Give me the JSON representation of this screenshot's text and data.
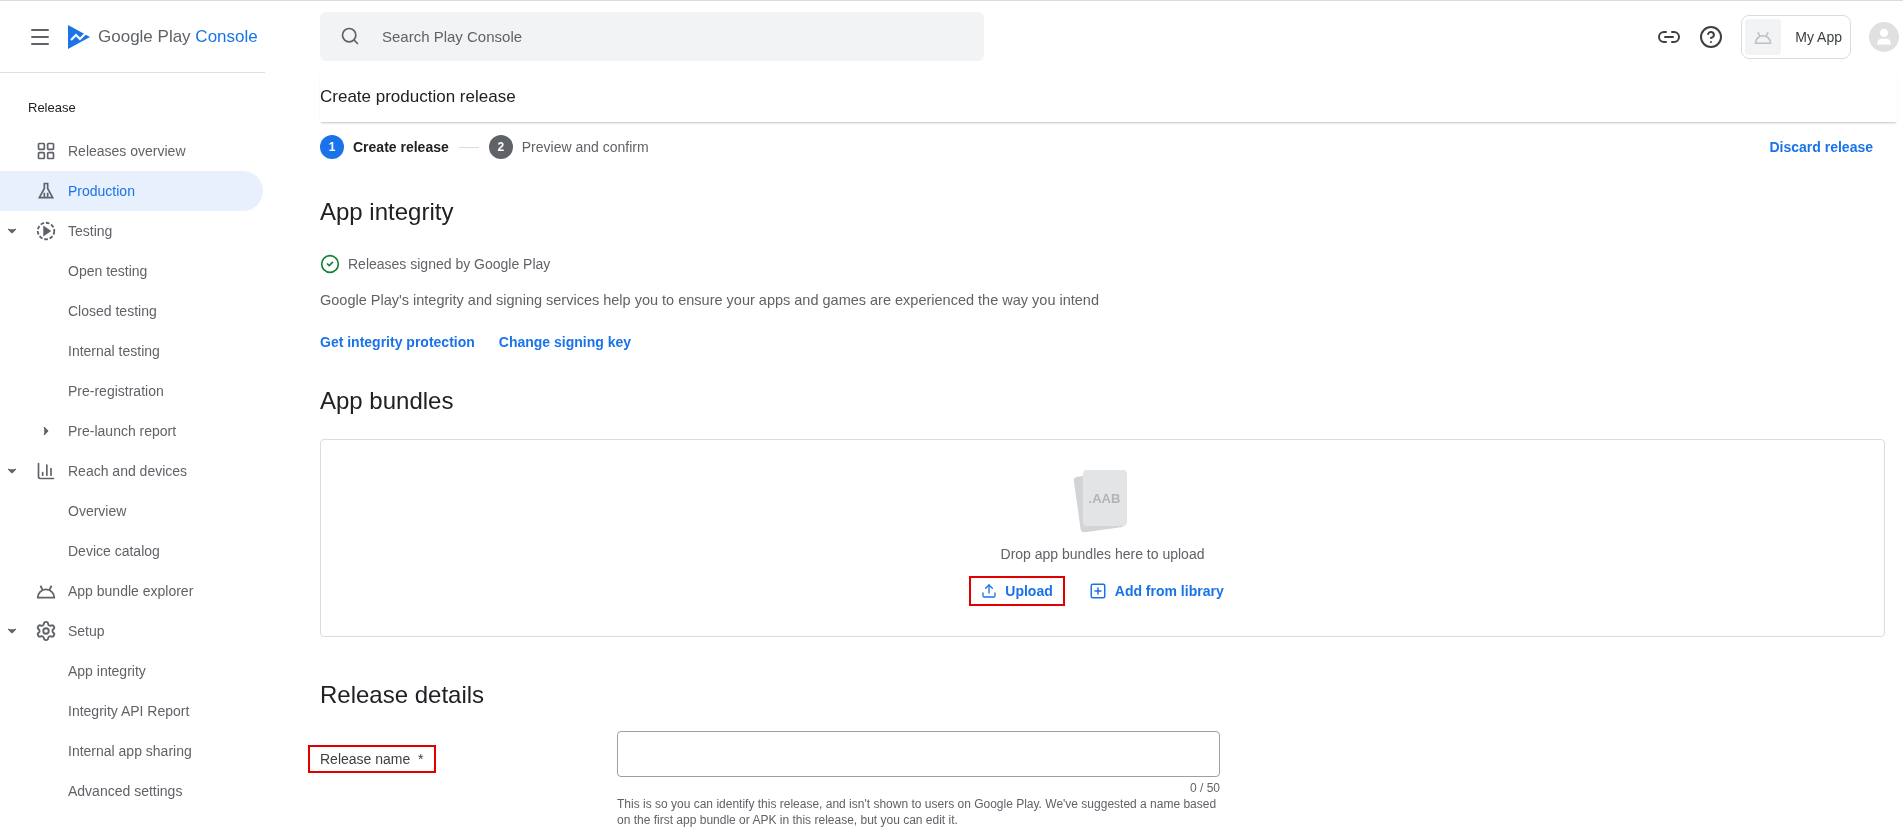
{
  "header": {
    "logo": {
      "brand": "Google Play",
      "accent": "Console"
    },
    "search": {
      "placeholder": "Search Play Console"
    },
    "app_chip": {
      "label": "My App"
    }
  },
  "sidebar": {
    "section": "Release",
    "items": [
      {
        "label": "Releases overview",
        "selected": false
      },
      {
        "label": "Production",
        "selected": true
      },
      {
        "label": "Testing",
        "selected": false,
        "expanded": true,
        "children": [
          {
            "label": "Open testing",
            "selected": false
          },
          {
            "label": "Closed testing",
            "selected": false
          },
          {
            "label": "Internal testing",
            "selected": false
          },
          {
            "label": "Pre-registration",
            "selected": false
          },
          {
            "label": "Pre-launch report",
            "selected": false,
            "expanded": false
          }
        ]
      },
      {
        "label": "Reach and devices",
        "selected": false,
        "expanded": true,
        "children": [
          {
            "label": "Overview",
            "selected": false
          },
          {
            "label": "Device catalog",
            "selected": false
          }
        ]
      },
      {
        "label": "App bundle explorer",
        "selected": false
      },
      {
        "label": "Setup",
        "selected": false,
        "expanded": true,
        "children": [
          {
            "label": "App integrity",
            "selected": false
          },
          {
            "label": "Integrity API Report",
            "selected": false
          },
          {
            "label": "Internal app sharing",
            "selected": false
          },
          {
            "label": "Advanced settings",
            "selected": false
          }
        ]
      }
    ]
  },
  "page": {
    "title": "Create production release",
    "steps": [
      {
        "number": "1",
        "label": "Create release",
        "selected": true
      },
      {
        "number": "2",
        "label": "Preview and confirm",
        "selected": false
      }
    ],
    "discard": "Discard release"
  },
  "app_integrity": {
    "heading": "App integrity",
    "status": "Releases signed by Google Play",
    "description": "Google Play's integrity and signing services help you to ensure your apps and games are experienced the way you intend",
    "links": [
      "Get integrity protection",
      "Change signing key"
    ]
  },
  "app_bundles": {
    "heading": "App bundles",
    "file_label": ".AAB",
    "drop_text": "Drop app bundles here to upload",
    "buttons": [
      {
        "kind": "upload",
        "label": "Upload",
        "highlighted": true
      },
      {
        "kind": "library",
        "label": "Add from library",
        "highlighted": false
      }
    ]
  },
  "release_details": {
    "heading": "Release details",
    "fields": [
      {
        "label": "Release name",
        "required_mark": "*",
        "highlighted": true,
        "counter": "0 / 50",
        "help": "This is so you can identify this release, and isn't shown to users on Google Play. We've suggested a name based on the first app bundle or APK in this release, but you can edit it."
      }
    ]
  }
}
